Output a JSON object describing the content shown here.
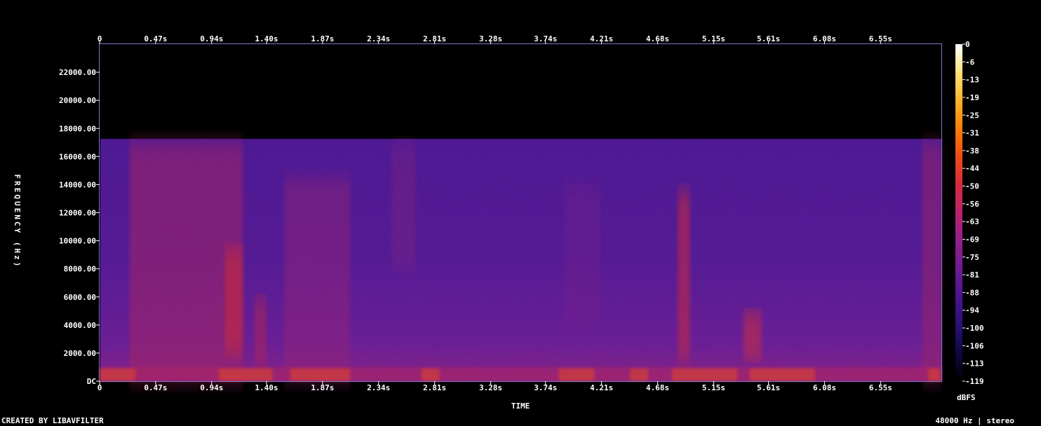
{
  "chart_data": {
    "type": "heatmap",
    "title": "",
    "xlabel": "TIME",
    "ylabel": "FREQUENCY (Hz)",
    "x_ticks": [
      "0",
      "0.47s",
      "0.94s",
      "1.40s",
      "1.87s",
      "2.34s",
      "2.81s",
      "3.28s",
      "3.74s",
      "4.21s",
      "4.68s",
      "5.15s",
      "5.61s",
      "6.08s",
      "6.55s"
    ],
    "x_tick_values": [
      0,
      0.47,
      0.94,
      1.4,
      1.87,
      2.34,
      2.81,
      3.28,
      3.74,
      4.21,
      4.68,
      5.15,
      5.61,
      6.08,
      6.55
    ],
    "xlim": [
      0,
      7.06
    ],
    "y_ticks": [
      "DC",
      "2000.00",
      "4000.00",
      "6000.00",
      "8000.00",
      "10000.00",
      "12000.00",
      "14000.00",
      "16000.00",
      "18000.00",
      "20000.00",
      "22000.00"
    ],
    "y_tick_values": [
      0,
      2000,
      4000,
      6000,
      8000,
      10000,
      12000,
      14000,
      16000,
      18000,
      20000,
      22000
    ],
    "ylim": [
      0,
      24000
    ],
    "content_cutoff_hz": 17250,
    "colorbar": {
      "label": "dBFS",
      "ticks": [
        "0",
        "-6",
        "-13",
        "-19",
        "-25",
        "-31",
        "-38",
        "-44",
        "-50",
        "-56",
        "-63",
        "-69",
        "-75",
        "-81",
        "-88",
        "-94",
        "-100",
        "-106",
        "-113",
        "-119"
      ],
      "range": [
        -119,
        0
      ],
      "colors": [
        "#000000",
        "#0e0840",
        "#2a0f78",
        "#4b1490",
        "#6f1a96",
        "#93208c",
        "#b8236c",
        "#d82a3e",
        "#ee4a14",
        "#f97e08",
        "#fbb42a",
        "#fde27a",
        "#ffffff"
      ]
    }
  },
  "footer": {
    "left": "CREATED BY LIBAVFILTER",
    "right": "48000 Hz | stereo"
  }
}
